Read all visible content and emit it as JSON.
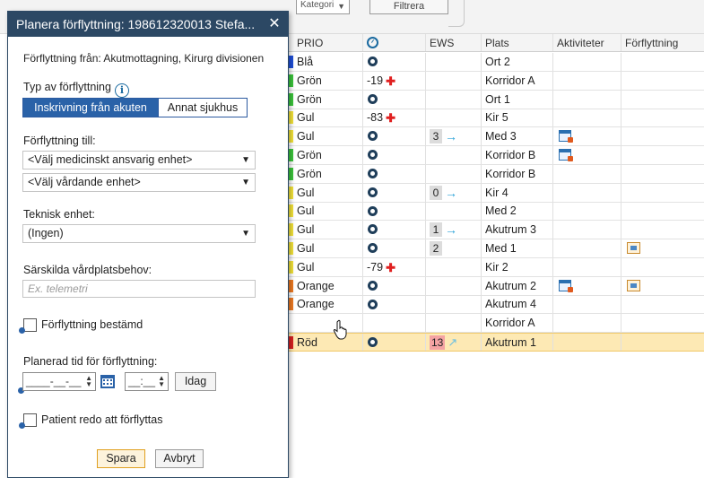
{
  "topbar": {
    "select_value": "Kategori",
    "filter_label": "Filtrera"
  },
  "table": {
    "headers": {
      "prio": "PRIO",
      "ews": "EWS",
      "plats": "Plats",
      "aktiviteter": "Aktiviteter",
      "forflyttning": "Förflyttning"
    },
    "rows": [
      {
        "prio": "Blå",
        "color": "#1f4fd8",
        "obs": "",
        "cross": false,
        "ews": "",
        "ews_arrow": "",
        "plats": "Ort 2",
        "akt": false,
        "forf": false
      },
      {
        "prio": "Grön",
        "color": "#3cc43c",
        "obs": "-19",
        "cross": true,
        "ews": "",
        "ews_arrow": "",
        "plats": "Korridor A",
        "akt": false,
        "forf": false
      },
      {
        "prio": "Grön",
        "color": "#3cc43c",
        "obs": "",
        "cross": false,
        "ews": "",
        "ews_arrow": "",
        "plats": "Ort 1",
        "akt": false,
        "forf": false
      },
      {
        "prio": "Gul",
        "color": "#f2e23a",
        "obs": "-83",
        "cross": true,
        "ews": "",
        "ews_arrow": "",
        "plats": "Kir 5",
        "akt": false,
        "forf": false
      },
      {
        "prio": "Gul",
        "color": "#f2e23a",
        "obs": "",
        "cross": false,
        "ews": "3",
        "ews_arrow": "right",
        "plats": "Med 3",
        "akt": true,
        "forf": false
      },
      {
        "prio": "Grön",
        "color": "#3cc43c",
        "obs": "",
        "cross": false,
        "ews": "",
        "ews_arrow": "",
        "plats": "Korridor B",
        "akt": true,
        "forf": false
      },
      {
        "prio": "Grön",
        "color": "#3cc43c",
        "obs": "",
        "cross": false,
        "ews": "",
        "ews_arrow": "",
        "plats": "Korridor B",
        "akt": false,
        "forf": false
      },
      {
        "prio": "Gul",
        "color": "#f2e23a",
        "obs": "",
        "cross": false,
        "ews": "0",
        "ews_arrow": "right",
        "plats": "Kir 4",
        "akt": false,
        "forf": false
      },
      {
        "prio": "Gul",
        "color": "#f2e23a",
        "obs": "",
        "cross": false,
        "ews": "",
        "ews_arrow": "",
        "plats": "Med 2",
        "akt": false,
        "forf": false
      },
      {
        "prio": "Gul",
        "color": "#f2e23a",
        "obs": "",
        "cross": false,
        "ews": "1",
        "ews_arrow": "right",
        "plats": "Akutrum 3",
        "akt": false,
        "forf": false
      },
      {
        "prio": "Gul",
        "color": "#f2e23a",
        "obs": "",
        "cross": false,
        "ews": "2",
        "ews_arrow": "",
        "plats": "Med 1",
        "akt": false,
        "forf": true
      },
      {
        "prio": "Gul",
        "color": "#f2e23a",
        "obs": "-79",
        "cross": true,
        "ews": "",
        "ews_arrow": "",
        "plats": "Kir 2",
        "akt": false,
        "forf": false
      },
      {
        "prio": "Orange",
        "color": "#ee7a22",
        "obs": "",
        "cross": false,
        "ews": "",
        "ews_arrow": "",
        "plats": "Akutrum 2",
        "akt": true,
        "forf": true
      },
      {
        "prio": "Orange",
        "color": "#ee7a22",
        "obs": "",
        "cross": false,
        "ews": "",
        "ews_arrow": "",
        "plats": "Akutrum 4",
        "akt": false,
        "forf": false
      },
      {
        "prio": "",
        "color": "",
        "obs": "",
        "cross": false,
        "ews": "",
        "ews_arrow": "",
        "plats": "Korridor A",
        "akt": false,
        "forf": false,
        "no_obs_icon": true
      },
      {
        "prio": "Röd",
        "color": "#d82020",
        "obs": "",
        "cross": false,
        "ews": "13",
        "ews_arrow": "up",
        "ews_red": true,
        "plats": "Akutrum 1",
        "akt": false,
        "forf": false,
        "selected": true
      }
    ]
  },
  "dialog": {
    "title": "Planera förflyttning: 198612320013 Stefa...",
    "from_text": "Förflyttning från: Akutmottagning, Kirurg divisionen",
    "type_label": "Typ av förflyttning",
    "type_options": [
      "Inskrivning från akuten",
      "Annat sjukhus"
    ],
    "to_label": "Förflyttning till:",
    "unit_select": "<Välj medicinskt ansvarig enhet>",
    "care_select": "<Välj vårdande enhet>",
    "tech_label": "Teknisk enhet:",
    "tech_select": "(Ingen)",
    "needs_label": "Särskilda vårdplatsbehov:",
    "needs_placeholder": "Ex. telemetri",
    "decided_label": "Förflyttning bestämd",
    "planned_label": "Planerad tid för förflyttning:",
    "date_value": "____-__-__",
    "time_value": "__:__",
    "today_label": "Idag",
    "ready_label": "Patient redo att förflyttas",
    "save_label": "Spara",
    "cancel_label": "Avbryt"
  }
}
